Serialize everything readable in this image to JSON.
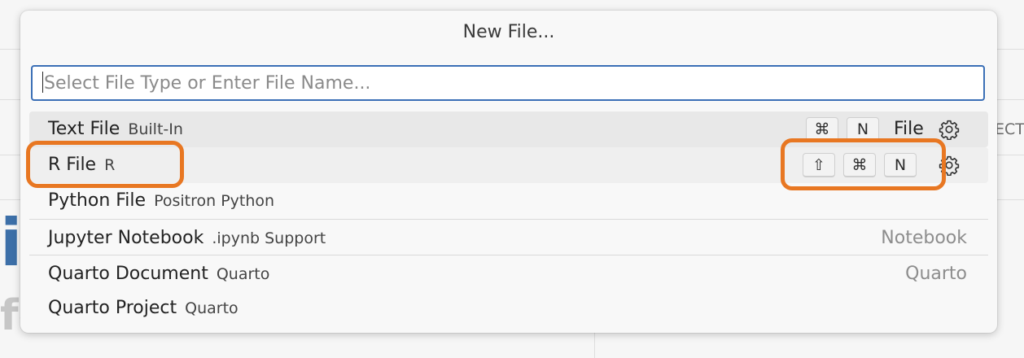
{
  "dialog": {
    "title": "New File...",
    "search": {
      "placeholder": "Select File Type or Enter File Name..."
    },
    "items": [
      {
        "label": "Text File",
        "description": "Built-In",
        "keybinding": [
          "⌘",
          "N"
        ],
        "category": "File",
        "icon": "gear-icon"
      },
      {
        "label": "R File",
        "description": "R",
        "keybinding": [
          "⇧",
          "⌘",
          "N"
        ],
        "icon": "gear-icon"
      },
      {
        "label": "Python File",
        "description": "Positron Python"
      },
      {
        "label": "Jupyter Notebook",
        "description": ".ipynb Support",
        "category": "Notebook"
      },
      {
        "label": "Quarto Document",
        "description": "Quarto",
        "category": "Quarto"
      },
      {
        "label": "Quarto Project",
        "description": "Quarto"
      }
    ]
  },
  "background": {
    "fragment_right": "ECT",
    "fragment_left_1": "i",
    "fragment_left_2": "fo"
  },
  "colors": {
    "accent": "#3b6fb6",
    "callout": "#e87722",
    "row_highlight": "#e8e8e8"
  }
}
